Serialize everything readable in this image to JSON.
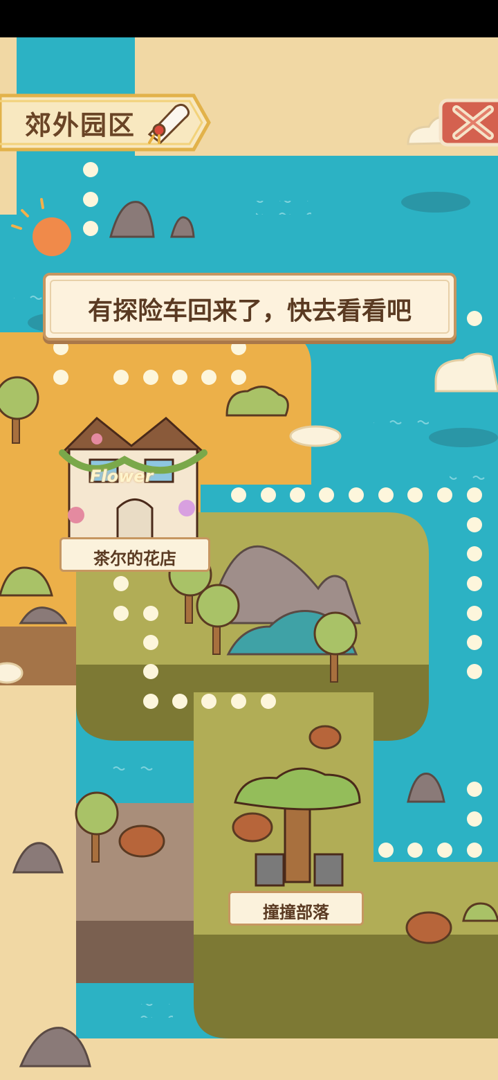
{
  "map": {
    "area_title": "郊外园区",
    "close_icon": "close-x-icon",
    "notice": "有探险车回来了，快去看看吧",
    "places": [
      {
        "name": "茶尔的花店",
        "sign": "Flower"
      },
      {
        "name": "撞撞部落"
      }
    ]
  },
  "colors": {
    "water": "#2cb2c4",
    "sand": "#f1d8a4",
    "orange_land": "#ecb049",
    "green_land": "#b1ad56",
    "brown_land": "#a98e7a",
    "path_dot": "#fdf6dc",
    "close_button": "#d4614f"
  }
}
